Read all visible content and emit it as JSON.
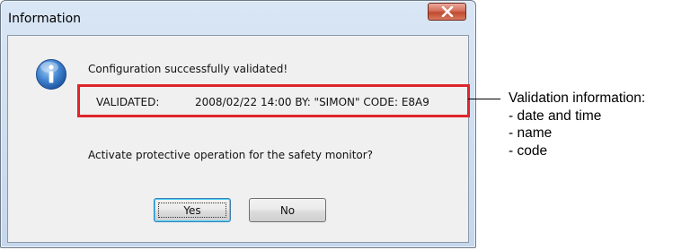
{
  "dialog": {
    "title": "Information",
    "message_1": "Configuration successfully validated!",
    "validation": {
      "label": "VALIDATED:",
      "value": "2008/02/22 14:00 BY: \"SIMON\" CODE: E8A9"
    },
    "message_2": "Activate protective operation for the safety monitor?",
    "buttons": {
      "yes_label": "Yes",
      "no_label": "No"
    },
    "icons": {
      "close": "close-icon",
      "info": "info-icon"
    }
  },
  "annotation": {
    "heading": "Validation information:",
    "items": [
      "- date and time",
      "- name",
      "- code"
    ]
  },
  "colors": {
    "highlight_border": "#e0252b",
    "close_button": "#c04a30",
    "info_icon": "#2f6fb8"
  }
}
